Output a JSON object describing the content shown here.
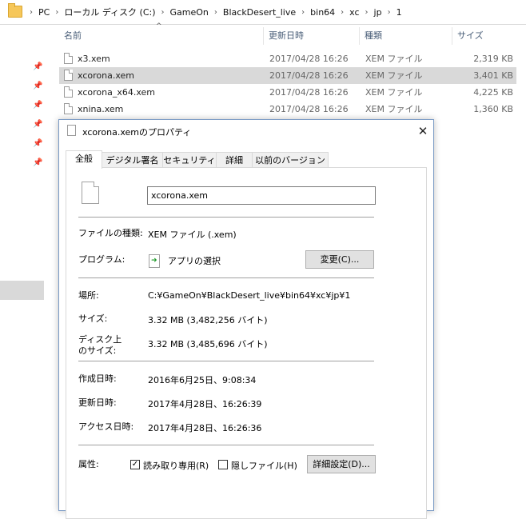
{
  "breadcrumb": [
    "PC",
    "ローカル ディスク (C:)",
    "GameOn",
    "BlackDesert_live",
    "bin64",
    "xc",
    "jp",
    "1"
  ],
  "columns": {
    "name": "名前",
    "date": "更新日時",
    "type": "種類",
    "size": "サイズ"
  },
  "files": [
    {
      "name": "x3.xem",
      "date": "2017/04/28 16:26",
      "type": "XEM ファイル",
      "size": "2,319 KB"
    },
    {
      "name": "xcorona.xem",
      "date": "2017/04/28 16:26",
      "type": "XEM ファイル",
      "size": "3,401 KB"
    },
    {
      "name": "xcorona_x64.xem",
      "date": "2017/04/28 16:26",
      "type": "XEM ファイル",
      "size": "4,225 KB"
    },
    {
      "name": "xnina.xem",
      "date": "2017/04/28 16:26",
      "type": "XEM ファイル",
      "size": "1,360 KB"
    }
  ],
  "dialog": {
    "title": "xcorona.xemのプロパティ",
    "close": "✕",
    "tabs": [
      "全般",
      "デジタル署名",
      "セキュリティ",
      "詳細",
      "以前のバージョン"
    ],
    "filename": "xcorona.xem",
    "file_type_label": "ファイルの種類:",
    "file_type_value": "XEM ファイル (.xem)",
    "program_label": "プログラム:",
    "program_value": "アプリの選択",
    "change_button": "変更(C)...",
    "location_label": "場所:",
    "location_value": "C:¥GameOn¥BlackDesert_live¥bin64¥xc¥jp¥1",
    "size_label": "サイズ:",
    "size_value": "3.32 MB (3,482,256 バイト)",
    "disk_size_label_1": "ディスク上",
    "disk_size_label_2": "のサイズ:",
    "disk_size_value": "3.32 MB (3,485,696 バイト)",
    "created_label": "作成日時:",
    "created_value": "2016年6月25日、9:08:34",
    "modified_label": "更新日時:",
    "modified_value": "2017年4月28日、16:26:39",
    "accessed_label": "アクセス日時:",
    "accessed_value": "2017年4月28日、16:26:36",
    "attributes_label": "属性:",
    "readonly_label": "読み取り専用(R)",
    "readonly_checked": "✓",
    "hidden_label": "隠しファイル(H)",
    "advanced_button": "詳細設定(D)..."
  }
}
